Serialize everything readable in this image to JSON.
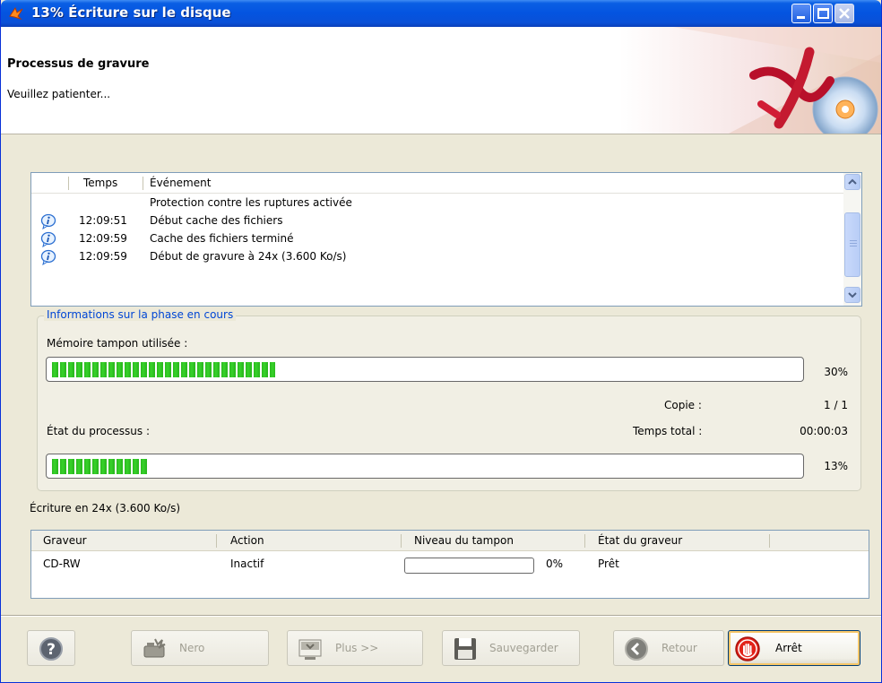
{
  "window": {
    "title": "13% Écriture sur le disque",
    "colors": {
      "titlebar": "#0454e0",
      "face": "#ece9d8",
      "progress": "#2bb91f",
      "accent": "#0046d5"
    }
  },
  "header": {
    "title": "Processus de gravure",
    "subtitle": "Veuillez patienter..."
  },
  "event_log": {
    "columns": [
      "Temps",
      "Événement"
    ],
    "rows": [
      {
        "icon": "none",
        "time": "",
        "message": "Protection contre les ruptures activée"
      },
      {
        "icon": "info-icon",
        "time": "12:09:51",
        "message": "Début cache des fichiers"
      },
      {
        "icon": "info-icon",
        "time": "12:09:59",
        "message": "Cache des fichiers terminé"
      },
      {
        "icon": "info-icon",
        "time": "12:09:59",
        "message": "Début de gravure à 24x (3.600 Ko/s)"
      }
    ]
  },
  "phase": {
    "legend": "Informations sur la phase en cours",
    "buffer_label": "Mémoire tampon utilisée :",
    "buffer_percent_text": "30%",
    "buffer_fraction": 0.3,
    "copy_label": "Copie :",
    "copy_value": "1 / 1",
    "process_label": "État du processus :",
    "total_time_label": "Temps total :",
    "total_time_value": "00:00:03",
    "process_percent_text": "13%",
    "process_fraction": 0.13
  },
  "status_text": "Écriture en 24x (3.600 Ko/s)",
  "recorders": {
    "columns": [
      "Graveur",
      "Action",
      "Niveau du tampon",
      "État du graveur"
    ],
    "rows": [
      {
        "recorder": "CD-RW",
        "action": "Inactif",
        "buffer_text": "0%",
        "buffer_fraction": 0,
        "state": "Prêt"
      }
    ]
  },
  "buttons": {
    "help": {
      "icon": "help-icon",
      "label": ""
    },
    "nero": {
      "icon": "nero-icon",
      "label": "Nero"
    },
    "more": {
      "icon": "more-icon",
      "label": "Plus >>"
    },
    "save": {
      "icon": "floppy-icon",
      "label": "Sauvegarder"
    },
    "back": {
      "icon": "back-arrow-icon",
      "label": "Retour"
    },
    "stop": {
      "icon": "stop-hand-icon",
      "label": "Arrêt"
    }
  }
}
